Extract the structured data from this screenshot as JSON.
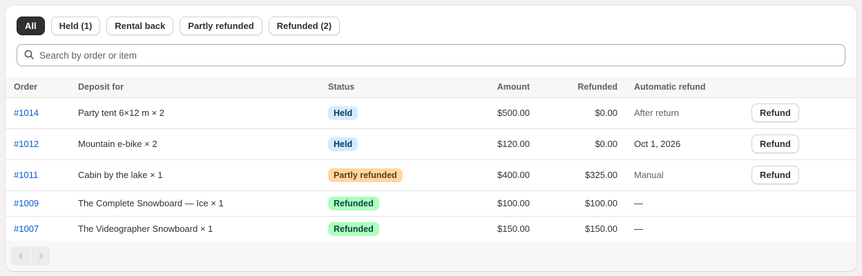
{
  "tabs": [
    {
      "label": "All",
      "active": true
    },
    {
      "label": "Held (1)",
      "active": false
    },
    {
      "label": "Rental back",
      "active": false
    },
    {
      "label": "Partly refunded",
      "active": false
    },
    {
      "label": "Refunded (2)",
      "active": false
    }
  ],
  "search": {
    "placeholder": "Search by order or item",
    "value": "",
    "icon": "search-icon"
  },
  "table": {
    "headers": {
      "order": "Order",
      "deposit": "Deposit for",
      "status": "Status",
      "amount": "Amount",
      "refunded": "Refunded",
      "auto": "Automatic refund"
    },
    "rows": [
      {
        "order": "#1014",
        "deposit": "Party tent 6×12 m × 2",
        "status": "Held",
        "amount": "$500.00",
        "refunded": "$0.00",
        "auto": "After return",
        "action": "Refund"
      },
      {
        "order": "#1012",
        "deposit": "Mountain e-bike × 2",
        "status": "Held",
        "amount": "$120.00",
        "refunded": "$0.00",
        "auto": "Oct 1, 2026",
        "action": "Refund"
      },
      {
        "order": "#1011",
        "deposit": "Cabin by the lake × 1",
        "status": "Partly refunded",
        "amount": "$400.00",
        "refunded": "$325.00",
        "auto": "Manual",
        "action": "Refund"
      },
      {
        "order": "#1009",
        "deposit": "The Complete Snowboard — Ice × 1",
        "status": "Refunded",
        "amount": "$100.00",
        "refunded": "$100.00",
        "auto": "—",
        "action": ""
      },
      {
        "order": "#1007",
        "deposit": "The Videographer Snowboard × 1",
        "status": "Refunded",
        "amount": "$150.00",
        "refunded": "$150.00",
        "auto": "—",
        "action": ""
      }
    ]
  },
  "pagination": {
    "prev_icon": "chevron-left-icon",
    "next_icon": "chevron-right-icon"
  },
  "colors": {
    "link": "#005bd3",
    "held_bg": "#d5ebff",
    "partly_bg": "#ffd6a4",
    "refunded_bg": "#affebf"
  }
}
